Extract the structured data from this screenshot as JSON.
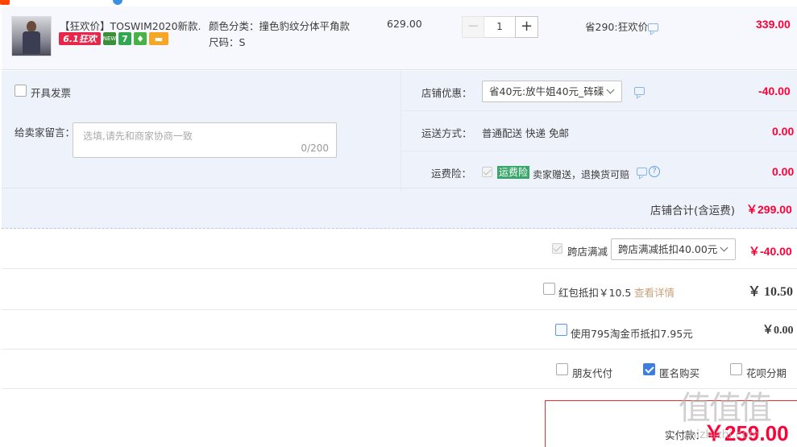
{
  "item": {
    "title": "【狂欢价】TOSWIM2020新款...",
    "badges": {
      "b61": "6.1狂欢",
      "new": "NEW",
      "seven": "7",
      "gift": "♦",
      "card": "▬"
    },
    "color": "颜色分类：撞色豹纹分体平角款",
    "size": "尺码：S",
    "price": "629.00",
    "quantity": "1",
    "qty_minus": "−",
    "qty_plus": "+",
    "promo": "省290:狂欢价",
    "subtotal": "339.00"
  },
  "shop": {
    "invoice_label": "开具发票",
    "message_label": "给卖家留言：",
    "message_placeholder": "选填,请先和商家协商一致",
    "message_count": "0/200",
    "discount_label": "店铺优惠：",
    "discount_selected": "省40元:放牛姐40元_砗磲",
    "discount_value": "-40.00",
    "shipping_label": "运送方式：",
    "shipping_value": "普通配送 快递 免邮",
    "shipping_price": "0.00",
    "insurance_label": "运费险：",
    "insurance_tag": "运费险",
    "insurance_text": "卖家赠送，退换货可赔",
    "insurance_help": "?",
    "insurance_price": "0.00",
    "total_label": "店铺合计(含运费)",
    "total_value": "￥299.00"
  },
  "order": {
    "cross_label": "跨店满减",
    "cross_selected": "跨店满减抵扣40.00元",
    "cross_value": "￥-40.00",
    "redpack_label": "红包抵扣￥10.5",
    "redpack_link": "查看详情",
    "redpack_value": "￥ 10.50",
    "coin_label": "使用795淘金币抵扣7.95元",
    "coin_value": "￥0.00",
    "friend_label": "朋友代付",
    "anon_label": "匿名购买",
    "huabei_label": "花呗分期",
    "pay_label": "实付款：",
    "pay_value": "￥259.00"
  },
  "watermark": {
    "logo": "值值值",
    "url": "zhizhizhi.com"
  },
  "colors": {
    "price_red": "#ff0036",
    "accent_blue": "#3d7fe0",
    "section_bg": "#eef3fb"
  }
}
